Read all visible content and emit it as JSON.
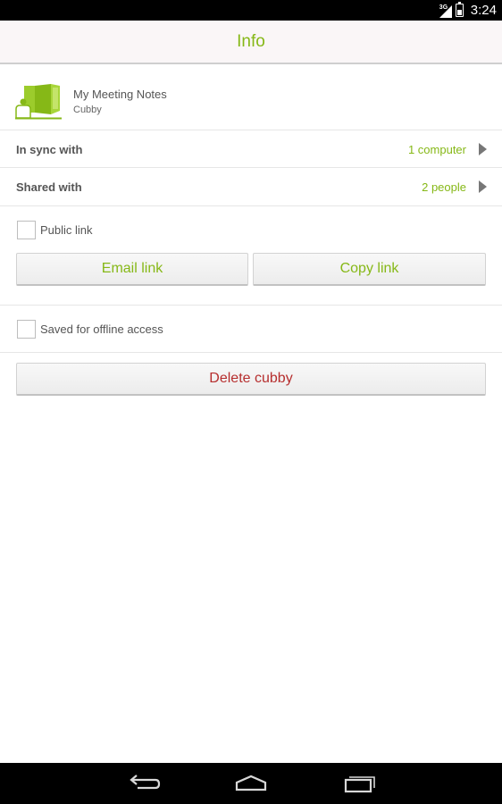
{
  "status_bar": {
    "network": "3G",
    "time": "3:24"
  },
  "header": {
    "title": "Info"
  },
  "item": {
    "name": "My Meeting Notes",
    "type": "Cubby",
    "icon": "cubby-folder-icon"
  },
  "rows": [
    {
      "label": "In sync with",
      "value": "1 computer"
    },
    {
      "label": "Shared with",
      "value": "2 people"
    }
  ],
  "public_link": {
    "label": "Public link",
    "checked": false,
    "email_button": "Email link",
    "copy_button": "Copy link"
  },
  "offline": {
    "label": "Saved for offline access",
    "checked": false
  },
  "delete_button": "Delete cubby",
  "colors": {
    "accent": "#86b817",
    "danger": "#b62e2e",
    "text": "#555555"
  },
  "nav": {
    "back": "back-icon",
    "home": "home-icon",
    "recents": "recents-icon"
  }
}
